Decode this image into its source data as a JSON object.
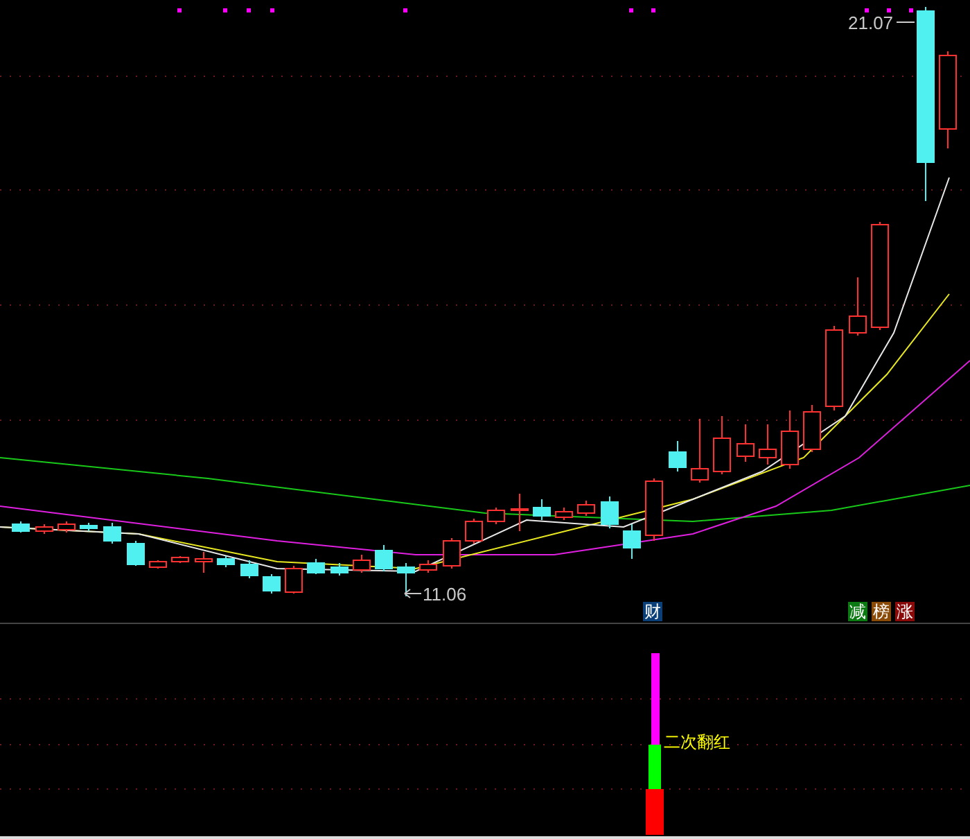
{
  "main_chart": {
    "high_label": "21.07",
    "low_label": "11.06",
    "badges": [
      {
        "text": "财",
        "color": "#0b3f78"
      },
      {
        "text": "减",
        "color": "#0b7a12"
      },
      {
        "text": "榜",
        "color": "#8a4a08"
      },
      {
        "text": "涨",
        "color": "#8a0a0a"
      }
    ]
  },
  "indicator": {
    "signal_label": "二次翻红"
  }
}
